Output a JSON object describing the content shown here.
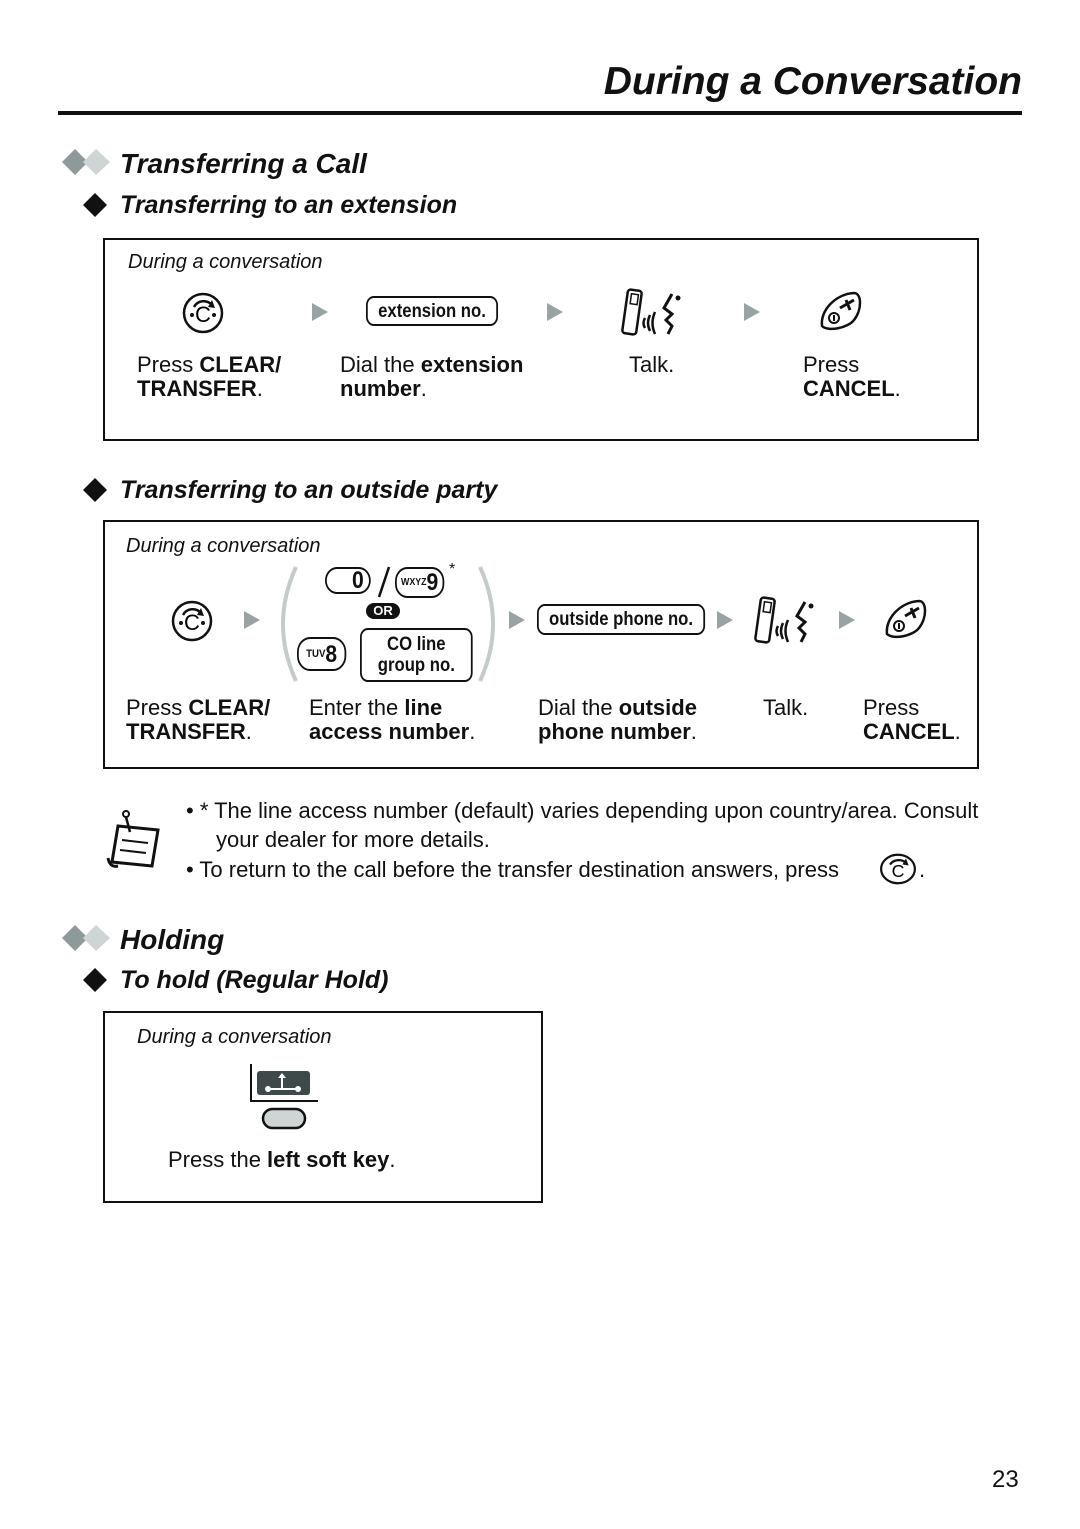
{
  "header": {
    "title": "During a Conversation"
  },
  "transfer": {
    "title": "Transferring a Call",
    "extension": {
      "title": "Transferring to an extension",
      "condition": "During a conversation",
      "key_label": "extension no.",
      "steps": [
        {
          "pre": "Press ",
          "bold": "CLEAR/ TRANSFER",
          "post": "."
        },
        {
          "pre": "Dial the ",
          "bold": "extension number",
          "post": "."
        },
        {
          "pre": "Talk.",
          "bold": "",
          "post": ""
        },
        {
          "pre": "Press ",
          "bold": "CANCEL",
          "post": "."
        }
      ]
    },
    "outside": {
      "title": "Transferring to an outside party",
      "condition": "During a conversation",
      "key0": "0",
      "key9_letters": "WXYZ",
      "key9": "9",
      "asterisk": "*",
      "or": "OR",
      "key8_letters": "TUV",
      "key8": "8",
      "co_line": "CO line group no.",
      "key_label": "outside phone no.",
      "steps": [
        {
          "pre": "Press ",
          "bold": "CLEAR/ TRANSFER",
          "post": "."
        },
        {
          "pre": "Enter the ",
          "bold": "line access number",
          "post": "."
        },
        {
          "pre": "Dial the ",
          "bold": "outside phone number",
          "post": "."
        },
        {
          "pre": "Talk.",
          "bold": "",
          "post": ""
        },
        {
          "pre": "Press ",
          "bold": "CANCEL",
          "post": "."
        }
      ]
    },
    "notes": [
      "• * The line access number (default) varies depending upon country/area. Consult",
      "your dealer for more details.",
      "• To return to the call before the transfer destination answers, press",
      "."
    ]
  },
  "holding": {
    "title": "Holding",
    "regular": {
      "title": "To hold (Regular Hold)",
      "condition": "During a conversation",
      "step": {
        "pre": "Press the ",
        "bold": "left soft key",
        "post": "."
      }
    }
  },
  "page_number": "23",
  "colors": {
    "arrow": "#9aa3a3",
    "diamond_dark": "#8e9a9a",
    "diamond_light": "#cfd5d5",
    "softkey": "#3e4a4a"
  }
}
